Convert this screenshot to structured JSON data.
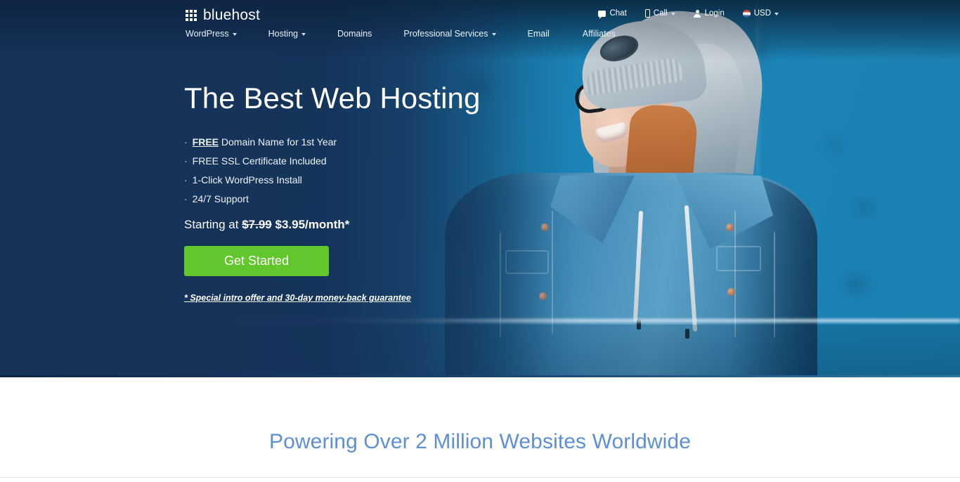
{
  "brand": {
    "name": "bluehost",
    "logo_icon": "grid-icon",
    "accent_green": "#62c62d",
    "navy": "#16335a",
    "wall_blue": "#1d86b8",
    "heading_blue": "#5d8fd4"
  },
  "topnav": [
    {
      "label": "Chat",
      "icon": "chat-bubble-icon",
      "caret": false
    },
    {
      "label": "Call",
      "icon": "phone-icon",
      "caret": true
    },
    {
      "label": "Login",
      "icon": "user-icon",
      "caret": false
    },
    {
      "label": "USD",
      "icon": "us-flag-icon",
      "caret": true
    }
  ],
  "mainnav": [
    {
      "label": "WordPress",
      "caret": true
    },
    {
      "label": "Hosting",
      "caret": true
    },
    {
      "label": "Domains",
      "caret": false
    },
    {
      "label": "Professional Services",
      "caret": true
    },
    {
      "label": "Email",
      "caret": false
    },
    {
      "label": "Affiliates",
      "caret": false
    }
  ],
  "hero": {
    "heading": "The Best Web Hosting",
    "bullets": [
      {
        "bullet": "·",
        "strong": "FREE",
        "rest": " Domain Name for 1st Year"
      },
      {
        "bullet": "·",
        "strong": "",
        "rest": "FREE SSL Certificate Included"
      },
      {
        "bullet": "·",
        "strong": "",
        "rest": "1-Click WordPress Install"
      },
      {
        "bullet": "·",
        "strong": "",
        "rest": "24/7 Support"
      }
    ],
    "price_prefix": "Starting at ",
    "price_old": "$7.99",
    "price_new": " $3.95/month*",
    "cta_label": "Get Started",
    "fineprint": "* Special intro offer and 30-day money-back guarantee",
    "image_alt": "smiling person in glasses, grey beanie and denim jacket against a blue wall"
  },
  "below": {
    "headline": "Powering Over 2 Million Websites Worldwide"
  }
}
